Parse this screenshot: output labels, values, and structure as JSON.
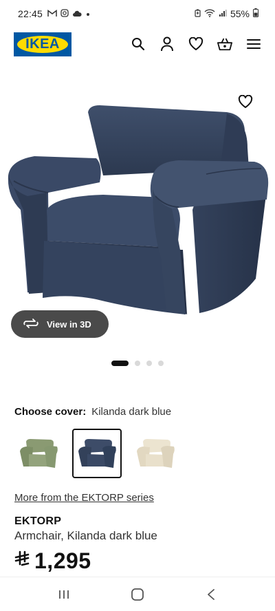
{
  "status_bar": {
    "time": "22:45",
    "battery": "55%",
    "icons": [
      "gmail-icon",
      "instagram-icon",
      "cloud-icon",
      "dot-icon",
      "battery-saver-icon",
      "wifi-icon",
      "signal-icon",
      "battery-icon"
    ]
  },
  "header": {
    "logo_text": "IKEA",
    "icons": [
      "search-icon",
      "account-icon",
      "wishlist-icon",
      "basket-icon",
      "menu-icon"
    ]
  },
  "gallery": {
    "view_3d_label": "View in 3D",
    "page_count": 4,
    "active_page": 1
  },
  "cover": {
    "label": "Choose cover:",
    "selected_value": "Kilanda dark blue",
    "swatches": [
      {
        "color": "#8a9a72",
        "selected": false
      },
      {
        "color": "#33415a",
        "selected": true
      },
      {
        "color": "#e6ddc8",
        "selected": false
      }
    ]
  },
  "product": {
    "series_link": "More from the EKTORP series",
    "name": "EKTORP",
    "description": "Armchair, Kilanda dark blue",
    "currency_symbol": "⃁",
    "price": "1,295"
  },
  "nav": {
    "icons": [
      "recent-apps-icon",
      "home-icon",
      "back-icon"
    ]
  },
  "colors": {
    "ikea_blue": "#0058a3",
    "ikea_yellow": "#ffdb00",
    "chair_fabric": "#3a4a66",
    "button_dark": "#4a4a4a"
  }
}
